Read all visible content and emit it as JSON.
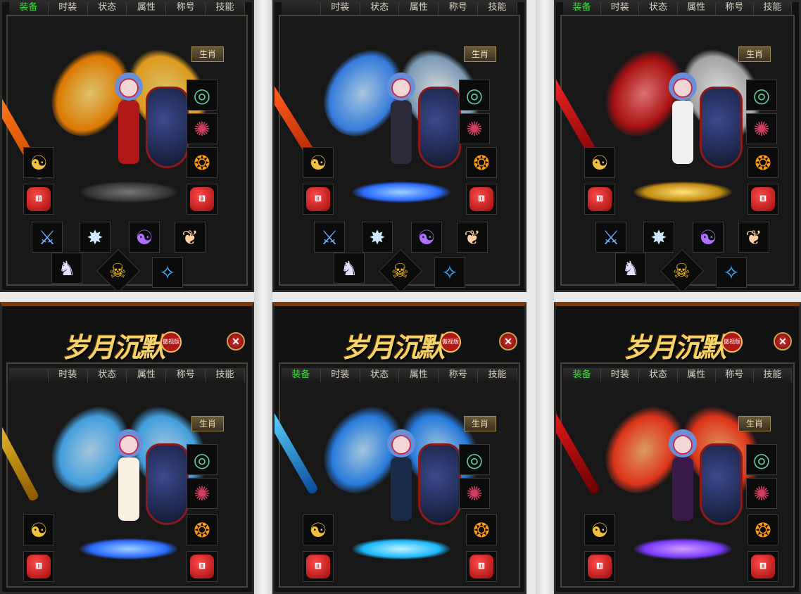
{
  "tabs": [
    "装备",
    "时装",
    "状态",
    "属性",
    "称号",
    "技能"
  ],
  "zodiac_label": "生肖",
  "logo": {
    "title": "岁月沉默",
    "badge": "傲视版",
    "close_symbol": "✕"
  },
  "icons": {
    "yin_yang": "☯",
    "dice": "⚅",
    "star": "✸",
    "skull": "☠"
  },
  "colors": {
    "active_tab": "#3fdc3f",
    "tab_text": "#d8d2c2",
    "frame": "#4a4236",
    "accent_brown": "#7a3d10"
  },
  "panels": [
    {
      "theme": "fire-gold",
      "sword": "#ff7a1a",
      "wing": "#ffb020",
      "body": "#b01818",
      "base": "#555555"
    },
    {
      "theme": "blue-ice",
      "sword": "#ff5a1a",
      "wing": "#3a8cff",
      "body": "#2a2a3a",
      "base": "#2a6aff"
    },
    {
      "theme": "silver-red",
      "sword": "#e02020",
      "wing": "#dcdcdc",
      "body": "#f0f0f0",
      "base": "#ffcc33"
    },
    {
      "theme": "gold-butterfly",
      "sword": "#f2c12e",
      "wing": "#4ab6ff",
      "body": "#f8f0e0",
      "base": "#2a6aff"
    },
    {
      "theme": "cyber-blue",
      "sword": "#5ad8ff",
      "wing": "#2a8cff",
      "body": "#1a2a4a",
      "base": "#1ab8ff"
    },
    {
      "theme": "crimson-demon",
      "sword": "#e81a1a",
      "wing": "#ff3a1a",
      "body": "#3a1a4a",
      "base": "#7a3aff"
    }
  ]
}
